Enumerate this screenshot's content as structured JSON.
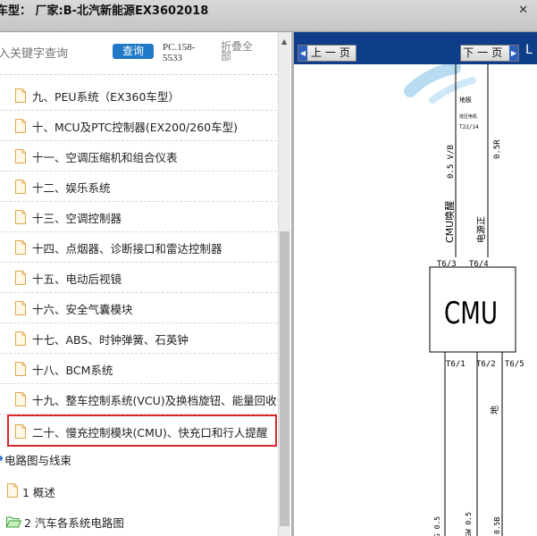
{
  "window": {
    "title": "车型：  厂家:B-北汽新能源EX3602018"
  },
  "search": {
    "placeholder": "入关键字查询",
    "button_label": "查询",
    "pc_code": "PC.158-5533",
    "collapse_label": "折叠全部"
  },
  "tree": {
    "items": [
      {
        "label": "九、PEU系统（EX360车型）"
      },
      {
        "label": "十、MCU及PTC控制器(EX200/260车型)"
      },
      {
        "label": "十一、空调压缩机和组合仪表"
      },
      {
        "label": "十二、娱乐系统"
      },
      {
        "label": "十三、空调控制器"
      },
      {
        "label": "十四、点烟器、诊断接口和雷达控制器"
      },
      {
        "label": "十五、电动后视镜"
      },
      {
        "label": "十六、安全气囊模块"
      },
      {
        "label": "十七、ABS、时钟弹簧、石英钟"
      },
      {
        "label": "十八、BCM系统"
      },
      {
        "label": "十九、整车控制系统(VCU)及换档旋钮、能量回收"
      },
      {
        "label": "二十、慢充控制模块(CMU)、快充口和行人提醒"
      }
    ],
    "section": "电路图与线束",
    "sub1": "1 概述",
    "sub2": "2 汽车各系统电路图"
  },
  "viewer": {
    "prev_label": "上一页",
    "next_label": "下一页",
    "right_cut": "L"
  },
  "circuit": {
    "module": "CMU",
    "ground_label": "地板",
    "ground_sub": "低压电机",
    "ground_pin": "T22/14",
    "wire_top_left": "0.5 V/B",
    "wire_top_right": "0.5R",
    "signal_left": "CMU唤醒",
    "signal_right": "电源正",
    "pin_t6_3": "T6/3",
    "pin_t6_4": "T6/4",
    "pin_t6_1": "T6/1",
    "pin_t6_2": "T6/2",
    "pin_t6_5": "T6/5",
    "ground_mid": "地",
    "wire_bot_1": "G 0.5",
    "wire_bot_2": "GW 0.5",
    "wire_bot_3": "0.5B"
  },
  "colors": {
    "nav_bg": "#0e3d8a",
    "button_blue": "#1f79c6",
    "highlight_red": "#d9262b"
  }
}
